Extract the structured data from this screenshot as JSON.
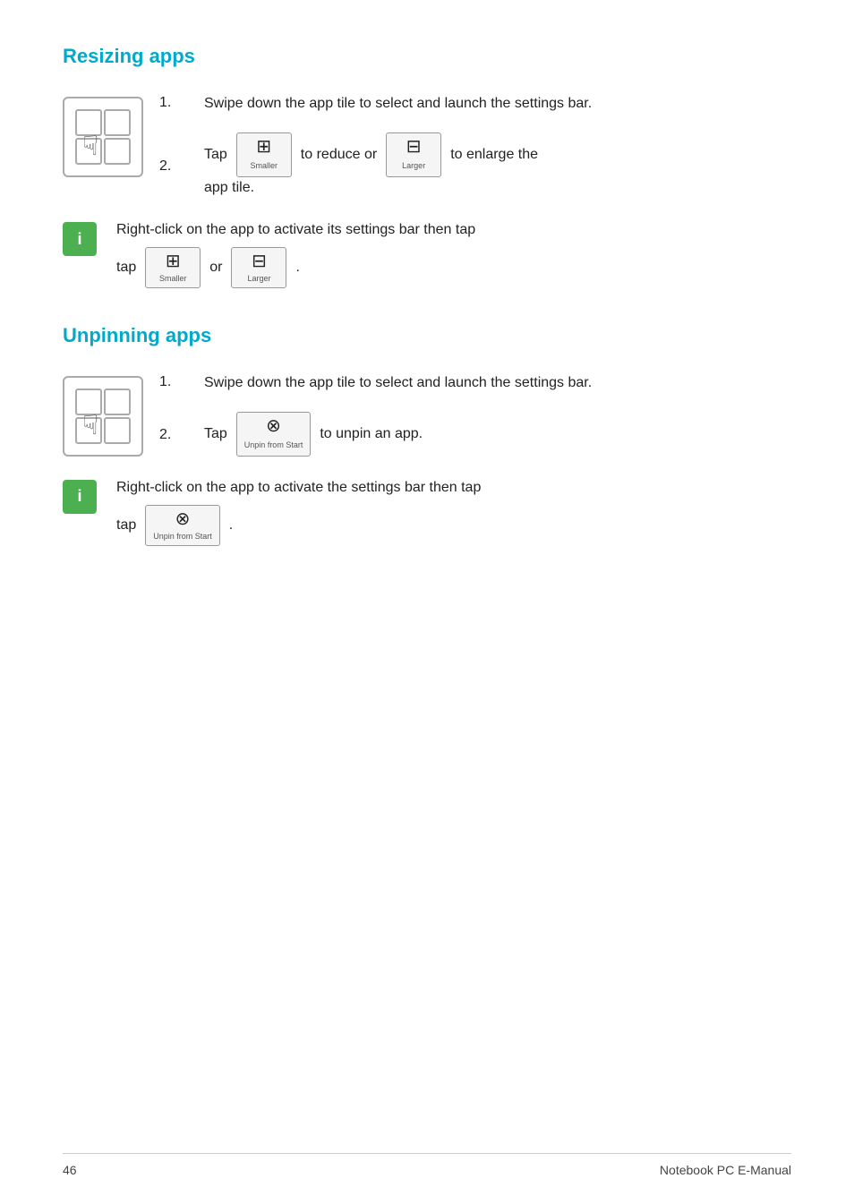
{
  "resizing": {
    "title": "Resizing apps",
    "step1": {
      "number": "1.",
      "text": "Swipe down the app tile to select and launch the settings bar."
    },
    "step2": {
      "number": "2.",
      "pre_text": "Tap",
      "mid_text": "to reduce or",
      "post_text": "to enlarge the app tile."
    },
    "note": {
      "text": "Right-click on the app to activate its settings bar then tap",
      "tap_end": "or",
      "period": "."
    }
  },
  "unpinning": {
    "title": "Unpinning apps",
    "step1": {
      "number": "1.",
      "text": "Swipe down the app tile to select and launch the settings bar."
    },
    "step2": {
      "number": "2.",
      "pre_text": "Tap",
      "post_text": "to unpin an app."
    },
    "note": {
      "text": "Right-click on the app to activate the settings bar then tap",
      "period": "."
    }
  },
  "footer": {
    "page_number": "46",
    "title": "Notebook PC E-Manual"
  },
  "buttons": {
    "smaller_label": "Smaller",
    "larger_label": "Larger",
    "unpin_label": "Unpin from Start"
  }
}
